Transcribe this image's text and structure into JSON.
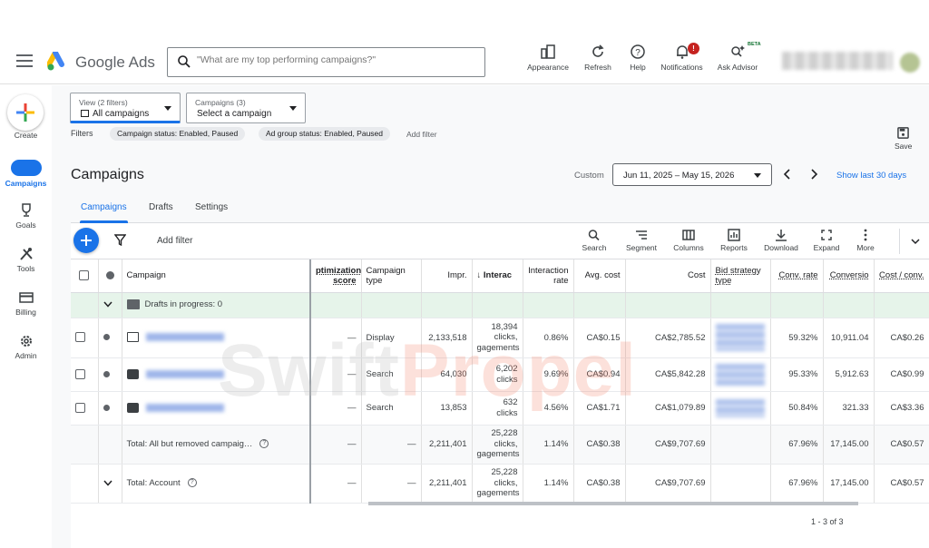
{
  "header": {
    "app_title": "Google Ads",
    "search_placeholder": "\"What are my top performing campaigns?\"",
    "tools": [
      {
        "label": "Appearance",
        "icon": "appearance-icon"
      },
      {
        "label": "Refresh",
        "icon": "refresh-icon"
      },
      {
        "label": "Help",
        "icon": "help-icon"
      },
      {
        "label": "Notifications",
        "icon": "bell-icon",
        "badge": "!"
      },
      {
        "label": "Ask Advisor",
        "icon": "sparkle-search-icon",
        "tag": "BETA"
      }
    ]
  },
  "nav": {
    "create_label": "Create",
    "items": [
      {
        "label": "Campaigns",
        "icon": "megaphone-icon",
        "active": true
      },
      {
        "label": "Goals",
        "icon": "trophy-icon"
      },
      {
        "label": "Tools",
        "icon": "tools-icon"
      },
      {
        "label": "Billing",
        "icon": "credit-card-icon"
      },
      {
        "label": "Admin",
        "icon": "gear-icon"
      }
    ]
  },
  "selectors": {
    "view_label": "View (2 filters)",
    "view_value": "All campaigns",
    "campaigns_label": "Campaigns (3)",
    "campaigns_value": "Select a campaign"
  },
  "filters": {
    "label": "Filters",
    "chips": [
      "Campaign status: Enabled, Paused",
      "Ad group status: Enabled, Paused"
    ],
    "add": "Add filter",
    "save": "Save"
  },
  "page": {
    "title": "Campaigns",
    "custom_label": "Custom",
    "date_range": "Jun 11, 2025 – May 15, 2026",
    "show_last": "Show last 30 days",
    "tabs": [
      "Campaigns",
      "Drafts",
      "Settings"
    ]
  },
  "toolbar": {
    "add_filter": "Add filter",
    "tools": [
      "Search",
      "Segment",
      "Columns",
      "Reports",
      "Download",
      "Expand",
      "More"
    ]
  },
  "table": {
    "headers": {
      "campaign": "Campaign",
      "opt_score": "ptimization score",
      "type": "Campaign type",
      "impr": "Impr.",
      "interactions": "↓ Interac",
      "int_rate": "Interaction rate",
      "avg_cost": "Avg. cost",
      "cost": "Cost",
      "bid": "Bid strategy type",
      "conv_rate": "Conv. rate",
      "conversions": "Conversio",
      "cost_conv": "Cost / conv."
    },
    "draft_row": "Drafts in progress: 0",
    "rows": [
      {
        "opt": "—",
        "type": "Display",
        "impr": "2,133,518",
        "inter1": "18,394",
        "inter2": "clicks,",
        "inter3": "gagements",
        "rate": "0.86%",
        "avg": "CA$0.15",
        "cost": "CA$2,785.52",
        "conv_rate": "59.32%",
        "conv": "10,911.04",
        "cpc": "CA$0.26"
      },
      {
        "opt": "—",
        "type": "Search",
        "impr": "64,030",
        "inter1": "6,202",
        "inter2": "clicks",
        "inter3": "",
        "rate": "9.69%",
        "avg": "CA$0.94",
        "cost": "CA$5,842.28",
        "conv_rate": "95.33%",
        "conv": "5,912.63",
        "cpc": "CA$0.99"
      },
      {
        "opt": "—",
        "type": "Search",
        "impr": "13,853",
        "inter1": "632",
        "inter2": "clicks",
        "inter3": "",
        "rate": "4.56%",
        "avg": "CA$1.71",
        "cost": "CA$1,079.89",
        "conv_rate": "50.84%",
        "conv": "321.33",
        "cpc": "CA$3.36"
      }
    ],
    "totals": [
      {
        "label": "Total: All but removed campaig…",
        "opt": "—",
        "type": "—",
        "impr": "2,211,401",
        "inter1": "25,228",
        "inter2": "clicks,",
        "inter3": "gagements",
        "rate": "1.14%",
        "avg": "CA$0.38",
        "cost": "CA$9,707.69",
        "conv_rate": "67.96%",
        "conv": "17,145.00",
        "cpc": "CA$0.57"
      },
      {
        "label": "Total: Account",
        "opt": "—",
        "type": "—",
        "impr": "2,211,401",
        "inter1": "25,228",
        "inter2": "clicks,",
        "inter3": "gagements",
        "rate": "1.14%",
        "avg": "CA$0.38",
        "cost": "CA$9,707.69",
        "conv_rate": "67.96%",
        "conv": "17,145.00",
        "cpc": "CA$0.57"
      }
    ],
    "page_count": "1 - 3 of 3"
  },
  "watermark": {
    "text_a": "Swift",
    "text_b": "Propel"
  },
  "colors": {
    "accent": "#1a73e8",
    "draft_bg": "#e6f4ea"
  }
}
